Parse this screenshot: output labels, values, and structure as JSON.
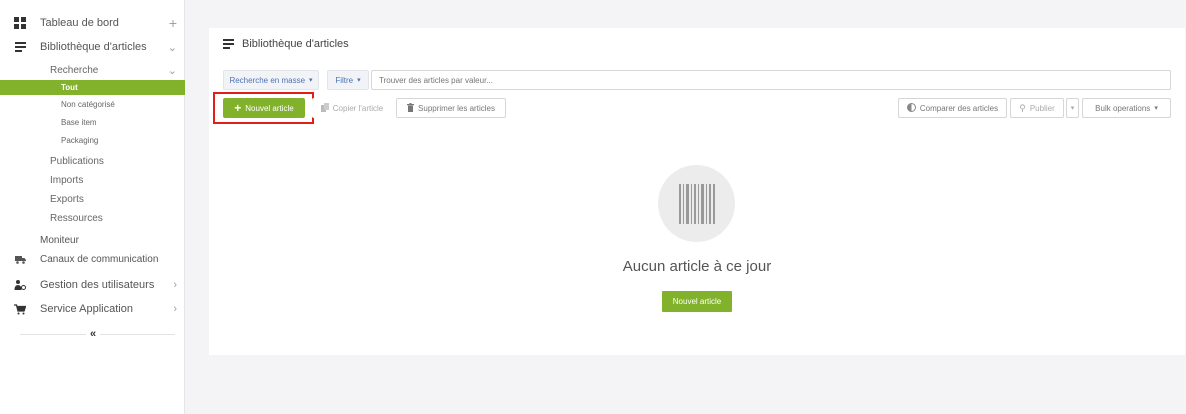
{
  "sidebar": {
    "items": [
      {
        "label": "Tableau de bord",
        "icon": "dashboard-grid-icon",
        "right": "+"
      },
      {
        "label": "Bibliothèque d'articles",
        "icon": "list-icon",
        "right": "⌄"
      },
      {
        "label": "Recherche",
        "right": "⌄"
      },
      {
        "label": "Tout"
      },
      {
        "label": "Non catégorisé"
      },
      {
        "label": "Base item"
      },
      {
        "label": "Packaging"
      },
      {
        "label": "Publications"
      },
      {
        "label": "Imports"
      },
      {
        "label": "Exports"
      },
      {
        "label": "Ressources"
      },
      {
        "label": "Moniteur"
      },
      {
        "label": "Canaux de communication",
        "icon": "truck-icon"
      },
      {
        "label": "Gestion des utilisateurs",
        "icon": "users-icon",
        "right": "›"
      },
      {
        "label": "Service Application",
        "icon": "cart-icon",
        "right": "›"
      }
    ],
    "collapse": "«"
  },
  "main": {
    "title": "Bibliothèque d'articles",
    "bulk_search": "Recherche en masse",
    "filter": "Filtre",
    "search_placeholder": "Trouver des articles par valeur...",
    "new_article": "Nouvel article",
    "copy_article": "Copier l'article",
    "delete_articles": "Supprimer les articles",
    "compare_articles": "Comparer des articles",
    "publish": "Publier",
    "bulk_operations": "Bulk operations",
    "empty_text": "Aucun article à ce jour",
    "empty_button": "Nouvel article"
  },
  "colors": {
    "accent": "#82b22c",
    "highlight": "#e31c1c"
  }
}
